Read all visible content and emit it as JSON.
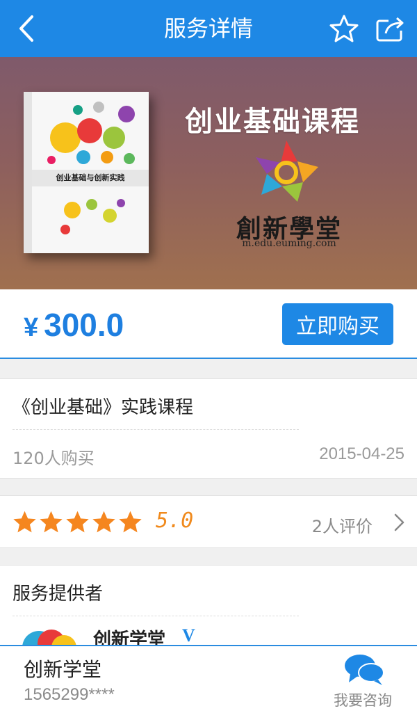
{
  "header": {
    "title": "服务详情",
    "back_icon": "back-arrow-icon",
    "favorite_icon": "star-outline-icon",
    "share_icon": "share-icon"
  },
  "banner": {
    "book_title": "创业基础与创新实践",
    "headline": "创业基础课程",
    "brand": "創新學堂",
    "url": "m.edu.euming.com"
  },
  "purchase": {
    "currency": "¥",
    "price": "300.0",
    "buy_label": "立即购买"
  },
  "product": {
    "name": "《创业基础》实践课程",
    "buyers": "120人购买",
    "date": "2015-04-25"
  },
  "rating": {
    "stars": 5,
    "score": "5.0",
    "review_count": "2人评价"
  },
  "provider": {
    "section_label": "服务提供者",
    "name": "创新学堂",
    "verified_mark": "V"
  },
  "bottom_bar": {
    "seller_name": "创新学堂",
    "seller_phone": "1565299****",
    "consult_label": "我要咨询"
  },
  "colors": {
    "primary": "#1e88e5",
    "price": "#1e7fe0",
    "star": "#f5861f"
  }
}
